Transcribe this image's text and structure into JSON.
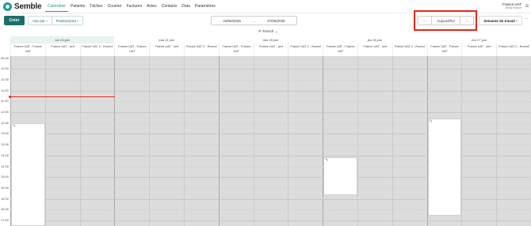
{
  "app": {
    "logo_text": "Semble",
    "nav": [
      "Calendrier",
      "Patients",
      "Tâches",
      "Courrier",
      "Factures",
      "Actes",
      "Contacts",
      "Data",
      "Paramètres"
    ],
    "active_nav": "Calendrier",
    "account": {
      "name": "France UAT",
      "sub": "Emily France"
    }
  },
  "toolbar": {
    "create_label": "Créer",
    "view_by_label": "Vue par",
    "practitioners_label": "Praticien(ne)",
    "date_from": "23/06/2025",
    "date_separator": "→",
    "date_to": "27/06/2025",
    "prev_icon": "←",
    "today_label": "Aujourd'hui",
    "next_icon": "→",
    "week_label": "Semaine de travail",
    "more_icon": "···",
    "practitioner_filter": "P. French"
  },
  "calendar": {
    "days": [
      {
        "label": "lun 23 juin",
        "today": true
      },
      {
        "label": "mar 24 juin",
        "today": false
      },
      {
        "label": "mer 25 juin",
        "today": false
      },
      {
        "label": "jeu 26 juin",
        "today": false
      },
      {
        "label": "ven 27 juin",
        "today": false
      }
    ],
    "resources": [
      "France UAT - France UAT",
      "France UAT - sert",
      "France UAT 2 - Room2"
    ],
    "times": [
      "09:30",
      "10:00",
      "10:30",
      "11:00",
      "11:30",
      "12:00",
      "12:30",
      "13:00",
      "13:30",
      "14:00",
      "14:30",
      "15:00",
      "15:30",
      "16:00",
      "16:30",
      "17:00"
    ],
    "colors": {
      "accent": "#1f9b8a",
      "primary_button": "#1a6e67",
      "now_line": "#e8231a",
      "highlight": "#e8231a",
      "unavailable": "#dcdcdc",
      "available": "#ffffff"
    }
  }
}
